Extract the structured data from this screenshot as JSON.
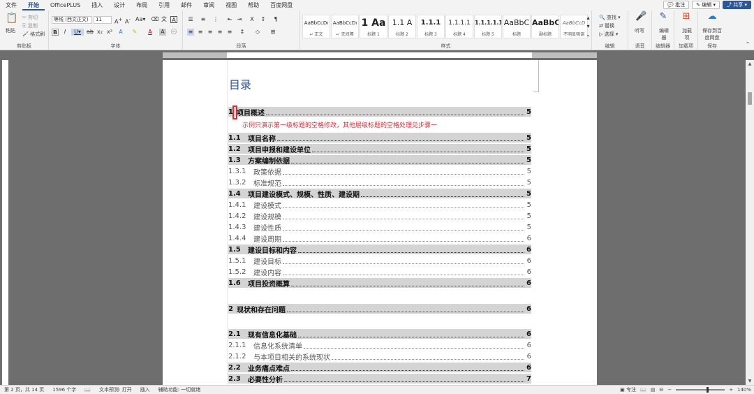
{
  "menu": {
    "items": [
      "文件",
      "开始",
      "OfficePLUS",
      "插入",
      "设计",
      "布局",
      "引用",
      "邮件",
      "审阅",
      "视图",
      "帮助",
      "百度网盘"
    ],
    "active_index": 1,
    "comment_label": "批注",
    "edit_label": "编辑",
    "share_label": "共享"
  },
  "ribbon": {
    "clipboard": {
      "paste": "粘贴",
      "cut": "剪切",
      "copy": "复制",
      "format_painter": "格式刷",
      "label": "剪贴板"
    },
    "font": {
      "font_name": "等线 (西文正文)",
      "font_size": "11",
      "label": "字体"
    },
    "paragraph": {
      "label": "段落"
    },
    "styles": {
      "cards": [
        {
          "preview": "AaBbCcDı",
          "name": "↵ 正文"
        },
        {
          "preview": "AaBbCcDı",
          "name": "↵ 无间隔"
        },
        {
          "preview": "1 Aa",
          "name": "标题 1"
        },
        {
          "preview": "1.1 A",
          "name": "标题 2"
        },
        {
          "preview": "1.1.1",
          "name": "标题 3"
        },
        {
          "preview": "1.1.1.1",
          "name": "标题 4"
        },
        {
          "preview": "1.1.1.1.1",
          "name": "标题 5"
        },
        {
          "preview": "AaBbC",
          "name": "标题"
        },
        {
          "preview": "AaBbC",
          "name": "副标题"
        },
        {
          "preview": "AaBbCcD",
          "name": "不明显强调"
        }
      ],
      "label": "样式"
    },
    "editing": {
      "find": "查找",
      "replace": "替换",
      "select": "选择",
      "label": "编辑"
    },
    "voice": {
      "dictate": "听写",
      "label": "语音"
    },
    "editor": {
      "name": "编辑器",
      "label": "编辑器"
    },
    "addins": {
      "name": "加载项",
      "label": "加载项"
    },
    "save": {
      "name": "保存到百度网盘",
      "label": "保存"
    }
  },
  "document": {
    "toc_title": "目录",
    "note": "示例只演示第一级标题的空格修改，其他层级标题的空格处理见步骤一",
    "entries": [
      {
        "num": "1",
        "text": "项目概述",
        "page": "5",
        "level": 1,
        "highlight": true
      },
      {
        "num": "1.1",
        "text": "项目名称",
        "page": "5",
        "level": 2,
        "highlight": true
      },
      {
        "num": "1.2",
        "text": "项目申报和建设单位",
        "page": "5",
        "level": 2,
        "highlight": true
      },
      {
        "num": "1.3",
        "text": "方案编制依据",
        "page": "5",
        "level": 2,
        "highlight": true
      },
      {
        "num": "1.3.1",
        "text": "政策依据",
        "page": "5",
        "level": 3,
        "highlight": false
      },
      {
        "num": "1.3.2",
        "text": "标准规范",
        "page": "5",
        "level": 3,
        "highlight": false
      },
      {
        "num": "1.4",
        "text": "项目建设模式、规模、性质、建设期",
        "page": "5",
        "level": 2,
        "highlight": true
      },
      {
        "num": "1.4.1",
        "text": "建设模式",
        "page": "5",
        "level": 3,
        "highlight": false
      },
      {
        "num": "1.4.2",
        "text": "建设规模",
        "page": "5",
        "level": 3,
        "highlight": false
      },
      {
        "num": "1.4.3",
        "text": "建设性质",
        "page": "5",
        "level": 3,
        "highlight": false
      },
      {
        "num": "1.4.4",
        "text": "建设周期",
        "page": "6",
        "level": 3,
        "highlight": false
      },
      {
        "num": "1.5",
        "text": "建设目标和内容",
        "page": "6",
        "level": 2,
        "highlight": true
      },
      {
        "num": "1.5.1",
        "text": "建设目标",
        "page": "6",
        "level": 3,
        "highlight": false
      },
      {
        "num": "1.5.2",
        "text": "建设内容",
        "page": "6",
        "level": 3,
        "highlight": false
      },
      {
        "num": "1.6",
        "text": "项目投资概算",
        "page": "6",
        "level": 2,
        "highlight": true
      },
      {
        "num": "2",
        "text": "现状和存在问题",
        "page": "6",
        "level": 1,
        "highlight": true
      },
      {
        "num": "2.1",
        "text": "现有信息化基础",
        "page": "6",
        "level": 2,
        "highlight": true
      },
      {
        "num": "2.1.1",
        "text": "信息化系统清单",
        "page": "6",
        "level": 3,
        "highlight": false
      },
      {
        "num": "2.1.2",
        "text": "与本项目相关的系统现状",
        "page": "6",
        "level": 3,
        "highlight": false
      },
      {
        "num": "2.2",
        "text": "业务痛点难点",
        "page": "6",
        "level": 2,
        "highlight": true
      },
      {
        "num": "2.3",
        "text": "必要性分析",
        "page": "7",
        "level": 2,
        "highlight": true
      }
    ]
  },
  "status": {
    "page": "第 2 页，共 14 页",
    "words": "1596 个字",
    "text_predict": "文本预测: 打开",
    "insert": "插入",
    "accessibility": "辅助功能: 一切就绪",
    "focus": "专注",
    "zoom": "140%"
  },
  "colors": {
    "accent": "#2b579a",
    "heading": "#2f5496",
    "note": "#d32f3a"
  }
}
